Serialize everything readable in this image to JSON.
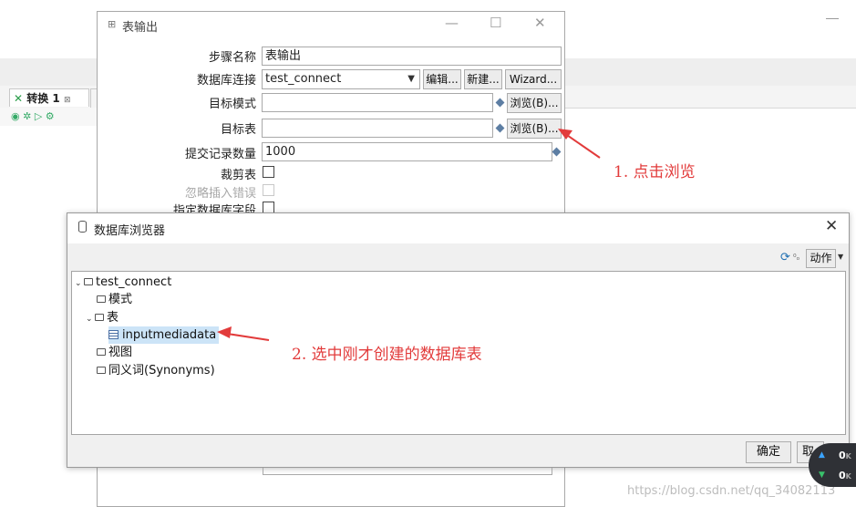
{
  "background": {
    "tab_label": "转换 1",
    "tab_close": "⊠"
  },
  "output_dialog": {
    "title": "表输出",
    "labels": {
      "step_name": "步骤名称",
      "db_connection": "数据库连接",
      "target_schema": "目标模式",
      "target_table": "目标表",
      "commit_size": "提交记录数量",
      "truncate": "裁剪表",
      "ignore_errors": "忽略插入错误",
      "specify_fields": "指定数据库字段"
    },
    "values": {
      "step_name": "表输出",
      "connection": "test_connect",
      "target_schema": "",
      "target_table": "",
      "commit_size": "1000"
    },
    "buttons": {
      "edit": "编辑...",
      "new": "新建...",
      "wizard": "Wizard...",
      "browse_schema": "浏览(B)...",
      "browse_table": "浏览(B)..."
    }
  },
  "db_browser": {
    "title": "数据库浏览器",
    "action_button": "动作",
    "ok_button": "确定",
    "cancel_button": "取",
    "tree": {
      "root": "test_connect",
      "schemas": "模式",
      "tables": "表",
      "table_item": "inputmediadata",
      "views": "视图",
      "synonyms": "同义词(Synonyms)"
    }
  },
  "annotations": {
    "step1": "1. 点击浏览",
    "step2": "2. 选中刚才创建的数据库表"
  },
  "watermark": "https://blog.csdn.net/qq_34082113",
  "network": {
    "up": "0",
    "down": "0",
    "unit": "K"
  },
  "colors": {
    "annotation_red": "#e23b3b",
    "selection_blue": "#cce4f7"
  }
}
